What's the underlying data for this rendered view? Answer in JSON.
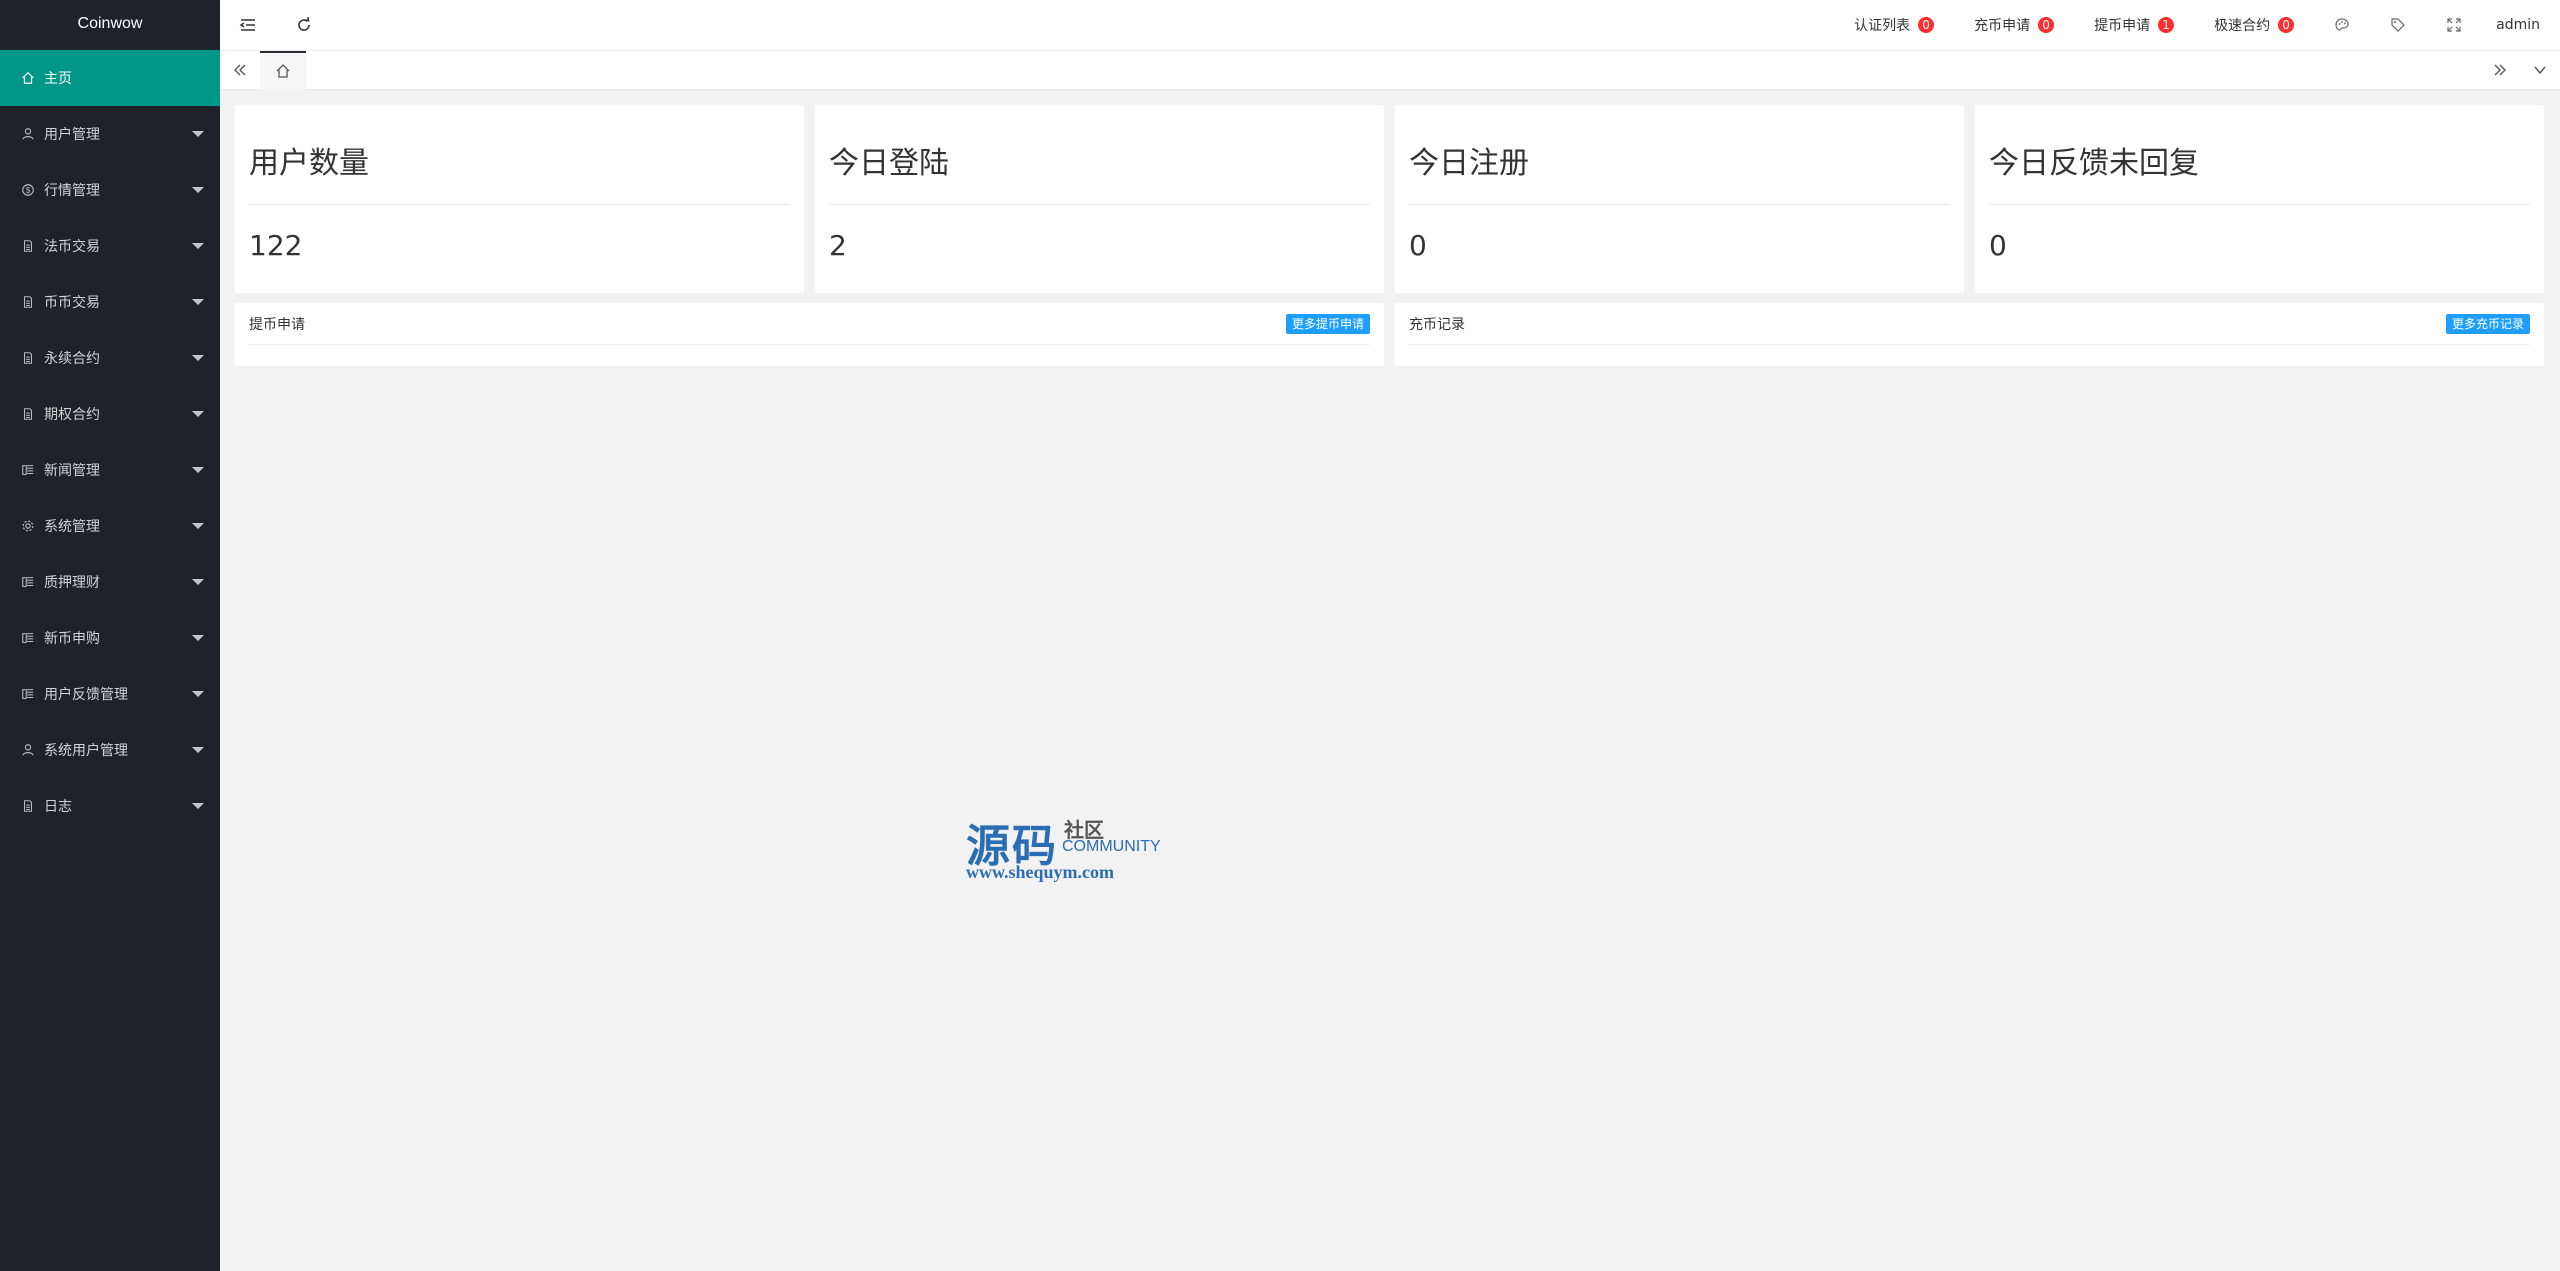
{
  "app": {
    "logo": "Coinwow"
  },
  "sidebar": {
    "items": [
      {
        "label": "主页",
        "icon": "home-icon",
        "active": true
      },
      {
        "label": "用户管理",
        "icon": "user-icon"
      },
      {
        "label": "行情管理",
        "icon": "dollar-icon"
      },
      {
        "label": "法币交易",
        "icon": "file-icon"
      },
      {
        "label": "币币交易",
        "icon": "file-icon"
      },
      {
        "label": "永续合约",
        "icon": "file-icon"
      },
      {
        "label": "期权合约",
        "icon": "file-icon"
      },
      {
        "label": "新闻管理",
        "icon": "news-icon"
      },
      {
        "label": "系统管理",
        "icon": "gear-icon"
      },
      {
        "label": "质押理财",
        "icon": "news-icon"
      },
      {
        "label": "新币申购",
        "icon": "news-icon"
      },
      {
        "label": "用户反馈管理",
        "icon": "news-icon"
      },
      {
        "label": "系统用户管理",
        "icon": "user-icon"
      },
      {
        "label": "日志",
        "icon": "file-icon"
      }
    ]
  },
  "header": {
    "links": [
      {
        "label": "认证列表",
        "count": "0"
      },
      {
        "label": "充币申请",
        "count": "0"
      },
      {
        "label": "提币申请",
        "count": "1"
      },
      {
        "label": "极速合约",
        "count": "0"
      }
    ],
    "user": "admin",
    "colors": {
      "badge": "#ff2d2d",
      "accent": "#009688"
    }
  },
  "stats": [
    {
      "title": "用户数量",
      "value": "122"
    },
    {
      "title": "今日登陆",
      "value": "2"
    },
    {
      "title": "今日注册",
      "value": "0"
    },
    {
      "title": "今日反馈未回复",
      "value": "0"
    }
  ],
  "panels": {
    "withdraw": {
      "title": "提币申请",
      "more": "更多提币申请"
    },
    "deposit": {
      "title": "充币记录",
      "more": "更多充币记录"
    }
  },
  "watermark": {
    "main": "源码",
    "sub": "社区",
    "community": "COMMUNITY",
    "url": "www.shequym.com"
  }
}
